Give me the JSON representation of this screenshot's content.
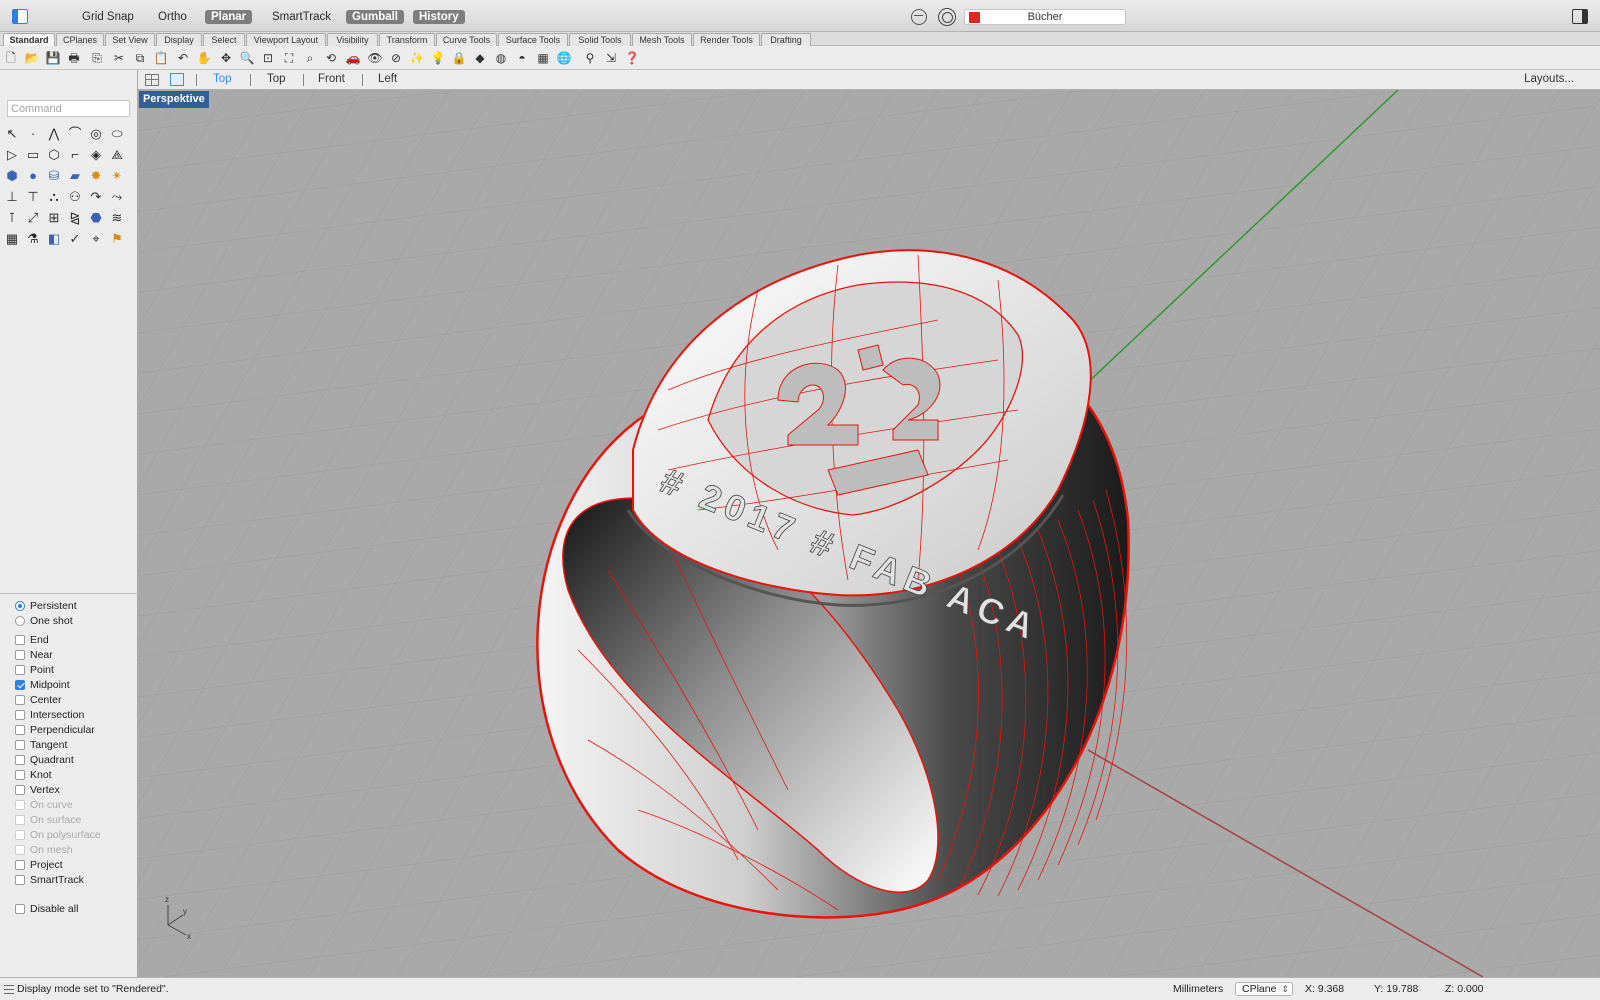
{
  "topbar": {
    "modes": [
      {
        "label": "Grid Snap",
        "on": false
      },
      {
        "label": "Ortho",
        "on": false
      },
      {
        "label": "Planar",
        "on": true
      },
      {
        "label": "SmartTrack",
        "on": false
      },
      {
        "label": "Gumball",
        "on": true
      },
      {
        "label": "History",
        "on": true
      }
    ],
    "layer_name": "Bücher",
    "layer_color": "#e52620"
  },
  "ribbon_tabs": [
    "Standard",
    "CPlanes",
    "Set View",
    "Display",
    "Select",
    "Viewport Layout",
    "Visibility",
    "Transform",
    "Curve Tools",
    "Surface Tools",
    "Solid Tools",
    "Mesh Tools",
    "Render Tools",
    "Drafting"
  ],
  "toolbar_icons": [
    "new-file-icon",
    "open-file-icon",
    "save-icon",
    "print-icon",
    "import-icon",
    "cut-icon",
    "copy-icon",
    "paste-icon",
    "undo-icon",
    "pan-hand-icon",
    "move-view-icon",
    "zoom-icon",
    "zoom-window-icon",
    "zoom-extents-icon",
    "zoom-selected-icon",
    "rotate-view-icon",
    "car-icon",
    "hide-icon",
    "lock-icon",
    "show-icon",
    "lightbulb-icon",
    "lock-object-icon",
    "layer-icon",
    "color-wheel-icon",
    "shaded-sphere-icon",
    "render-icon",
    "globe-icon",
    "select-filter-icon",
    "gumball-icon",
    "help-icon"
  ],
  "viewbar": {
    "tabs": [
      "Top",
      "Top",
      "Front",
      "Left"
    ],
    "active_index": 0,
    "layouts_label": "Layouts..."
  },
  "command": {
    "placeholder": "Command",
    "value": ""
  },
  "osnap": {
    "mode": [
      {
        "label": "Persistent",
        "selected": true
      },
      {
        "label": "One shot",
        "selected": false
      }
    ],
    "items": [
      {
        "label": "End",
        "checked": false,
        "enabled": true
      },
      {
        "label": "Near",
        "checked": false,
        "enabled": true
      },
      {
        "label": "Point",
        "checked": false,
        "enabled": true
      },
      {
        "label": "Midpoint",
        "checked": true,
        "enabled": true
      },
      {
        "label": "Center",
        "checked": false,
        "enabled": true
      },
      {
        "label": "Intersection",
        "checked": false,
        "enabled": true
      },
      {
        "label": "Perpendicular",
        "checked": false,
        "enabled": true
      },
      {
        "label": "Tangent",
        "checked": false,
        "enabled": true
      },
      {
        "label": "Quadrant",
        "checked": false,
        "enabled": true
      },
      {
        "label": "Knot",
        "checked": false,
        "enabled": true
      },
      {
        "label": "Vertex",
        "checked": false,
        "enabled": true
      },
      {
        "label": "On curve",
        "checked": false,
        "enabled": false
      },
      {
        "label": "On surface",
        "checked": false,
        "enabled": false
      },
      {
        "label": "On polysurface",
        "checked": false,
        "enabled": false
      },
      {
        "label": "On mesh",
        "checked": false,
        "enabled": false
      },
      {
        "label": "Project",
        "checked": false,
        "enabled": true
      },
      {
        "label": "SmartTrack",
        "checked": false,
        "enabled": true
      }
    ],
    "disable_all": {
      "label": "Disable all",
      "checked": false
    }
  },
  "viewport": {
    "label": "Perspektive",
    "ring_text": "# 2017 # FAB ACA",
    "axis_labels": {
      "z": "z",
      "y": "y",
      "x": "x"
    },
    "colors": {
      "wire": "#e8140c",
      "y_axis": "#2d9a2d",
      "x_axis": "#a83f3f",
      "background": "#a9a9a9"
    }
  },
  "status": {
    "message": "Display mode set to \"Rendered\".",
    "units": "Millimeters",
    "cplane": "CPlane",
    "x": "X: 9.368",
    "y": "Y: 19.788",
    "z": "Z: 0.000"
  }
}
